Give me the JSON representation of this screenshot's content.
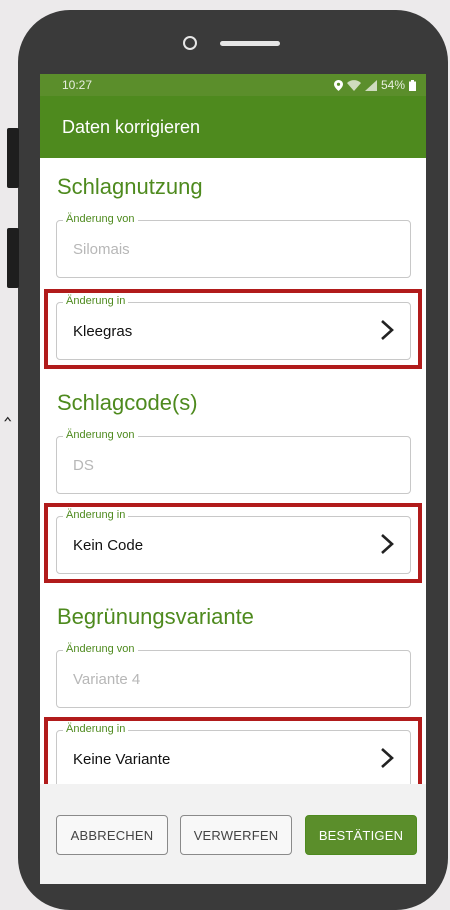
{
  "status_bar": {
    "time": "10:27",
    "battery": "54%"
  },
  "app_bar": {
    "title": "Daten korrigieren"
  },
  "sections": [
    {
      "title": "Schlagnutzung",
      "from_label": "Änderung von",
      "from_value": "Silomais",
      "to_label": "Änderung in",
      "to_value": "Kleegras"
    },
    {
      "title": "Schlagcode(s)",
      "from_label": "Änderung von",
      "from_value": "DS",
      "to_label": "Änderung in",
      "to_value": "Kein Code"
    },
    {
      "title": "Begrünungsvariante",
      "from_label": "Änderung von",
      "from_value": "Variante 4",
      "to_label": "Änderung in",
      "to_value": "Keine Variante"
    }
  ],
  "buttons": {
    "cancel": "ABBRECHEN",
    "discard": "VERWERFEN",
    "confirm": "BESTÄTIGEN"
  },
  "colors": {
    "primary": "#4e8a1e",
    "highlight": "#b11b1b"
  },
  "icons": [
    "location-icon",
    "wifi-icon",
    "signal-icon",
    "battery-icon",
    "chevron-right-icon"
  ]
}
